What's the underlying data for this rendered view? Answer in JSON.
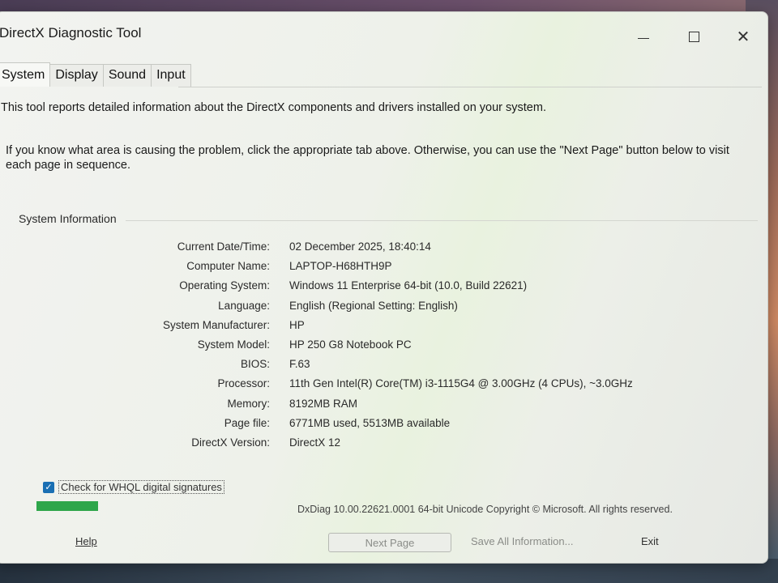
{
  "window": {
    "title": "DirectX Diagnostic Tool",
    "minimize_icon": "minimize-icon",
    "maximize_icon": "maximize-icon",
    "close_icon": "close-icon",
    "close_glyph": "✕"
  },
  "tabs": [
    {
      "label": "System",
      "active": true
    },
    {
      "label": "Display",
      "active": false
    },
    {
      "label": "Sound",
      "active": false
    },
    {
      "label": "Input",
      "active": false
    }
  ],
  "intro": {
    "line1": "This tool reports detailed information about the DirectX components and drivers installed on your system.",
    "line2": "If you know what area is causing the problem, click the appropriate tab above.  Otherwise, you can use the \"Next Page\" button below to visit each page in sequence."
  },
  "system_info": {
    "group_label": "System Information",
    "rows": [
      {
        "label": "Current Date/Time:",
        "value": "02 December 2025, 18:40:14"
      },
      {
        "label": "Computer Name:",
        "value": "LAPTOP-H68HTH9P"
      },
      {
        "label": "Operating System:",
        "value": "Windows 11 Enterprise 64-bit (10.0, Build 22621)"
      },
      {
        "label": "Language:",
        "value": "English (Regional Setting: English)"
      },
      {
        "label": "System Manufacturer:",
        "value": "HP"
      },
      {
        "label": "System Model:",
        "value": "HP 250 G8 Notebook PC"
      },
      {
        "label": "BIOS:",
        "value": "F.63"
      },
      {
        "label": "Processor:",
        "value": "11th Gen Intel(R) Core(TM) i3-1115G4 @ 3.00GHz (4 CPUs), ~3.0GHz"
      },
      {
        "label": "Memory:",
        "value": "8192MB RAM"
      },
      {
        "label": "Page file:",
        "value": "6771MB used, 5513MB available"
      },
      {
        "label": "DirectX Version:",
        "value": "DirectX 12"
      }
    ]
  },
  "whql": {
    "label": "Check for WHQL digital signatures",
    "checked": true,
    "check_glyph": "✓"
  },
  "progress": {
    "fraction": 1.0,
    "color": "#2ea64a"
  },
  "footer": {
    "copyright": "DxDiag 10.00.22621.0001 64-bit Unicode  Copyright © Microsoft. All rights reserved.",
    "help": "Help",
    "next_page": "Next Page",
    "save_all": "Save All Information...",
    "exit": "Exit"
  }
}
